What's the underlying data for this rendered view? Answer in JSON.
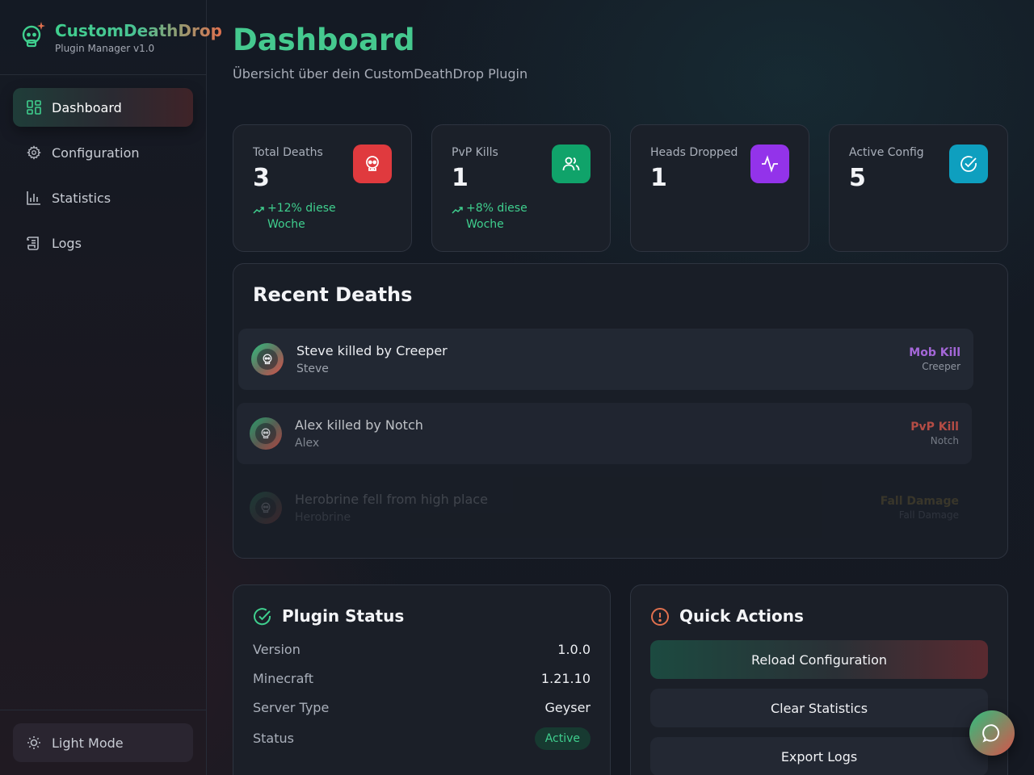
{
  "brand": {
    "title": "CustomDeathDrop",
    "subtitle": "Plugin Manager v1.0"
  },
  "sidebar": {
    "items": [
      {
        "label": "Dashboard",
        "icon": "dashboard-grid-icon",
        "active": true
      },
      {
        "label": "Configuration",
        "icon": "gear-icon",
        "active": false
      },
      {
        "label": "Statistics",
        "icon": "bar-chart-icon",
        "active": false
      },
      {
        "label": "Logs",
        "icon": "scroll-icon",
        "active": false
      }
    ],
    "theme_toggle": {
      "label": "Light Mode",
      "icon": "sun-icon"
    }
  },
  "header": {
    "title": "Dashboard",
    "subtitle": "Übersicht über dein CustomDeathDrop Plugin"
  },
  "stats": [
    {
      "label": "Total Deaths",
      "value": "3",
      "trend": "+12% diese Woche",
      "icon": "skull-icon",
      "color": "#e03a3e"
    },
    {
      "label": "PvP Kills",
      "value": "1",
      "trend": "+8% diese Woche",
      "icon": "users-icon",
      "color": "#10a36a"
    },
    {
      "label": "Heads Dropped",
      "value": "1",
      "trend": "",
      "icon": "activity-icon",
      "color": "#9333ea"
    },
    {
      "label": "Active Config",
      "value": "5",
      "trend": "",
      "icon": "check-circle-icon",
      "color": "#0e9fbf"
    }
  ],
  "recent_deaths": {
    "title": "Recent Deaths",
    "items": [
      {
        "message": "Steve killed by Creeper",
        "player": "Steve",
        "type": "Mob Kill",
        "source": "Creeper",
        "type_color": "#a467d8"
      },
      {
        "message": "Alex killed by Notch",
        "player": "Alex",
        "type": "PvP Kill",
        "source": "Notch",
        "type_color": "#e05a4e"
      },
      {
        "message": "Herobrine fell from high place",
        "player": "Herobrine",
        "type": "Fall Damage",
        "source": "Fall Damage",
        "type_color": "#c9a23a"
      }
    ]
  },
  "plugin_status": {
    "title": "Plugin Status",
    "rows": [
      {
        "key": "Version",
        "value": "1.0.0"
      },
      {
        "key": "Minecraft",
        "value": "1.21.10"
      },
      {
        "key": "Server Type",
        "value": "Geyser"
      }
    ],
    "status_key": "Status",
    "status_value": "Active"
  },
  "quick_actions": {
    "title": "Quick Actions",
    "buttons": [
      "Reload Configuration",
      "Clear Statistics",
      "Export Logs"
    ]
  },
  "colors": {
    "accent_green": "#45c98f",
    "accent_red": "#e03a3e",
    "accent_orange": "#e0704e"
  }
}
